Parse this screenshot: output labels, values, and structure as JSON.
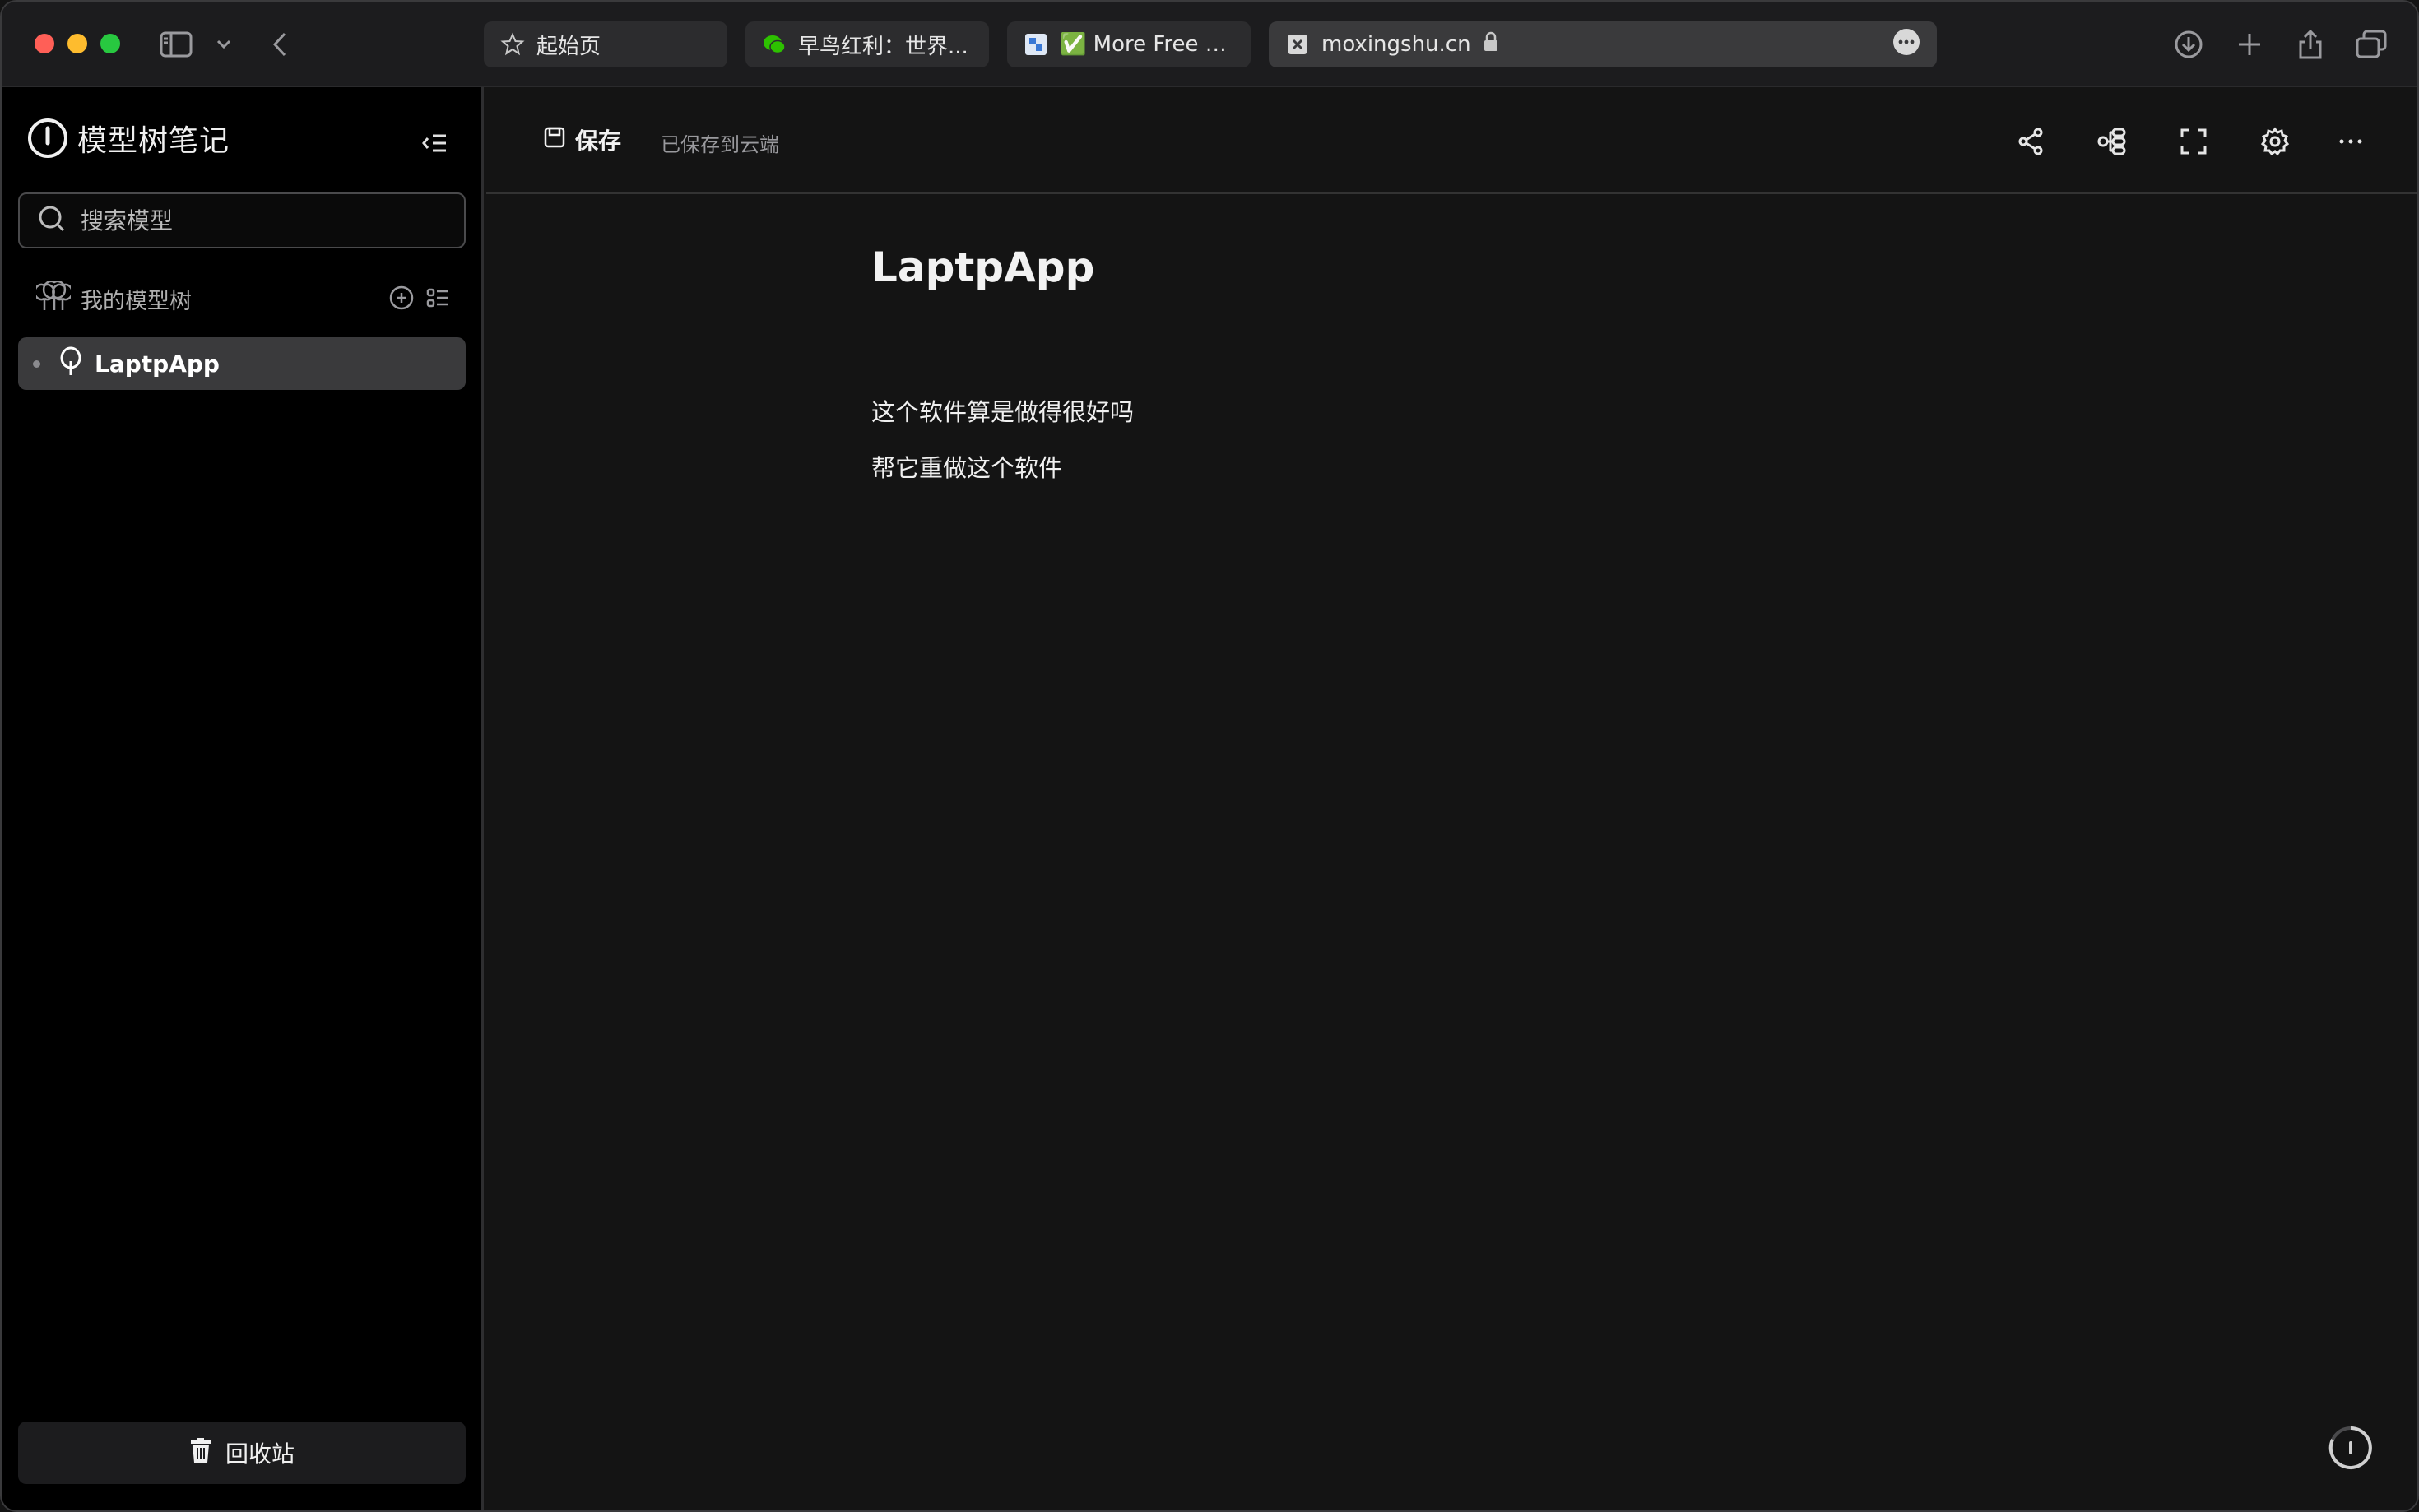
{
  "browser": {
    "tabs": [
      {
        "label": "起始页",
        "icon": "star-icon"
      },
      {
        "label": "早鸟红利：世界...",
        "icon": "wechat-icon"
      },
      {
        "label": "✅ More Free D...",
        "icon": "image-favicon"
      },
      {
        "label": "moxingshu.cn",
        "icon": "close-favicon",
        "secure": true
      }
    ]
  },
  "sidebar": {
    "brand": "模型树笔记",
    "search_placeholder": "搜索模型",
    "section_label": "我的模型树",
    "items": [
      {
        "label": "LaptpApp"
      }
    ],
    "trash_label": "回收站"
  },
  "toolbar": {
    "save_label": "保存",
    "save_status": "已保存到云端"
  },
  "document": {
    "title": "LaptpApp",
    "lines": [
      "这个软件算是做得很好吗",
      "帮它重做这个软件"
    ]
  },
  "colors": {
    "accent_selected": "#3a3a3c",
    "background": "#141414",
    "sidebar_bg": "#000000"
  }
}
